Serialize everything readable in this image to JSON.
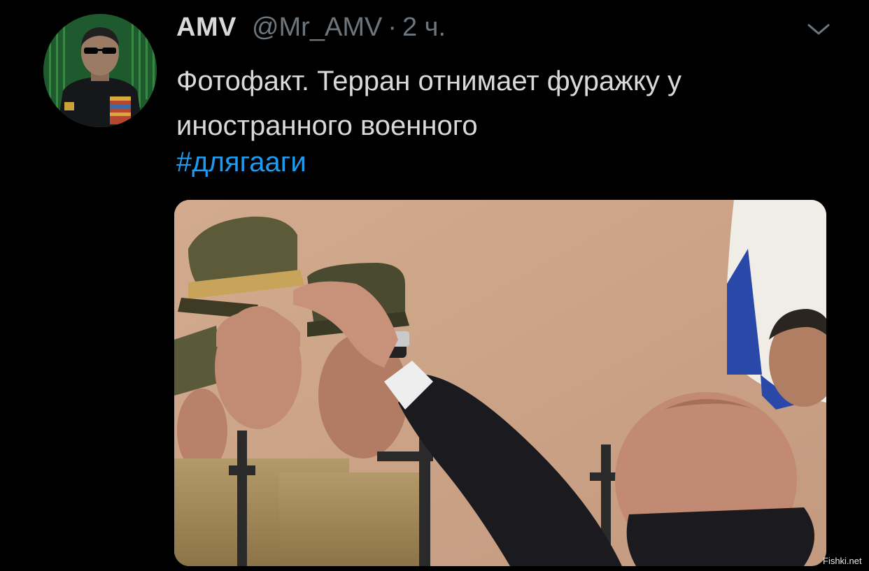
{
  "tweet": {
    "author_name": "AMV",
    "author_handle": "@Mr_AMV",
    "separator": "·",
    "timestamp": "2 ч.",
    "text": "Фотофакт. Терран отнимает фуражку у иностранного военного",
    "hashtag": "#длягааги",
    "more_menu_icon": "chevron-down-icon",
    "avatar_icon": "avatar-person-sunglasses",
    "media_description_icon": "photo"
  },
  "watermark": "Fishki.net",
  "colors": {
    "background": "#000000",
    "text_primary": "#d9d9d9",
    "text_secondary": "#6e767d",
    "link": "#1d9bf0"
  }
}
